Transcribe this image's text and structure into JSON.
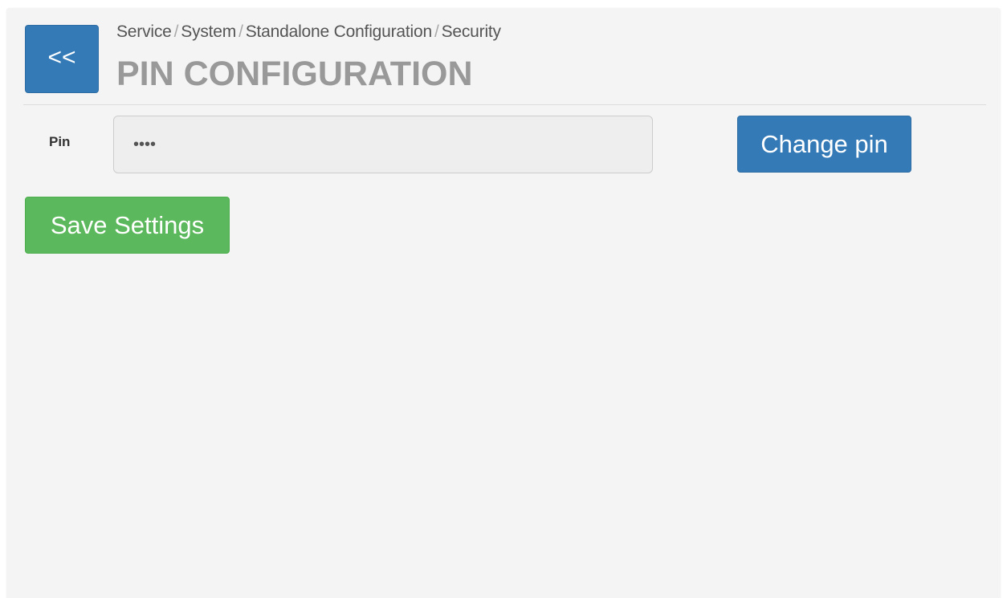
{
  "nav": {
    "back_label": "<<"
  },
  "breadcrumb": {
    "items": [
      "Service",
      "System",
      "Standalone Configuration",
      "Security"
    ],
    "separator": "/"
  },
  "page": {
    "title": "PIN CONFIGURATION"
  },
  "form": {
    "pin_label": "Pin",
    "pin_value": "••••",
    "change_pin_label": "Change pin",
    "save_label": "Save Settings"
  },
  "colors": {
    "primary": "#337ab7",
    "success": "#5cb85c",
    "panel_bg": "#f4f4f4",
    "title_text": "#999999"
  }
}
